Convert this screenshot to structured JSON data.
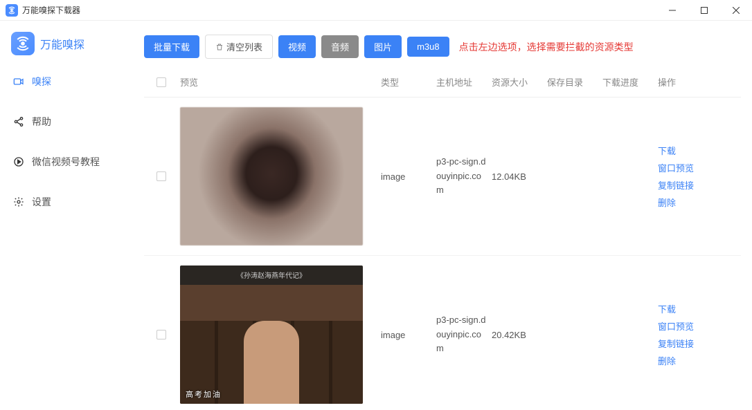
{
  "window": {
    "title": "万能嗅探下载器"
  },
  "brand": {
    "name": "万能嗅探"
  },
  "sidebar": {
    "items": [
      {
        "label": "嗅探"
      },
      {
        "label": "帮助"
      },
      {
        "label": "微信视频号教程"
      },
      {
        "label": "设置"
      }
    ]
  },
  "toolbar": {
    "batch_download": "批量下载",
    "clear_list": "清空列表",
    "video": "视频",
    "audio": "音频",
    "image": "图片",
    "m3u8": "m3u8",
    "hint": "点击左边选项，选择需要拦截的资源类型"
  },
  "columns": {
    "preview": "预览",
    "type": "类型",
    "host": "主机地址",
    "size": "资源大小",
    "dir": "保存目录",
    "progress": "下载进度",
    "action": "操作"
  },
  "rows": [
    {
      "type": "image",
      "host": "p3-pc-sign.douyinpic.com",
      "size": "12.04KB",
      "thumb_style": "blur",
      "subtitle": ""
    },
    {
      "type": "image",
      "host": "p3-pc-sign.douyinpic.com",
      "size": "20.42KB",
      "thumb_style": "office",
      "subtitle": "高考加油",
      "topcaption": "《孙涛赵海燕年代记》"
    }
  ],
  "actions": {
    "download": "下载",
    "preview_window": "窗口预览",
    "copy_link": "复制链接",
    "delete": "删除"
  }
}
